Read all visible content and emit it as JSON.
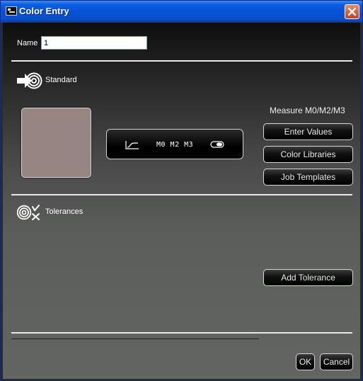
{
  "window": {
    "title": "Color Entry"
  },
  "name": {
    "label": "Name",
    "value": "1"
  },
  "standard": {
    "label": "Standard",
    "swatch_color": "#968580",
    "measure_title": "Measure M0/M2/M3",
    "measure_modes": "M0 M2 M3",
    "buttons": {
      "enter_values": "Enter Values",
      "color_libraries": "Color Libraries",
      "job_templates": "Job Templates"
    }
  },
  "tolerances": {
    "label": "Tolerances",
    "add_button": "Add Tolerance"
  },
  "footer": {
    "ok": "OK",
    "cancel": "Cancel"
  },
  "colors": {
    "titlebar": "#0552d8",
    "close_button": "#c4401a"
  }
}
